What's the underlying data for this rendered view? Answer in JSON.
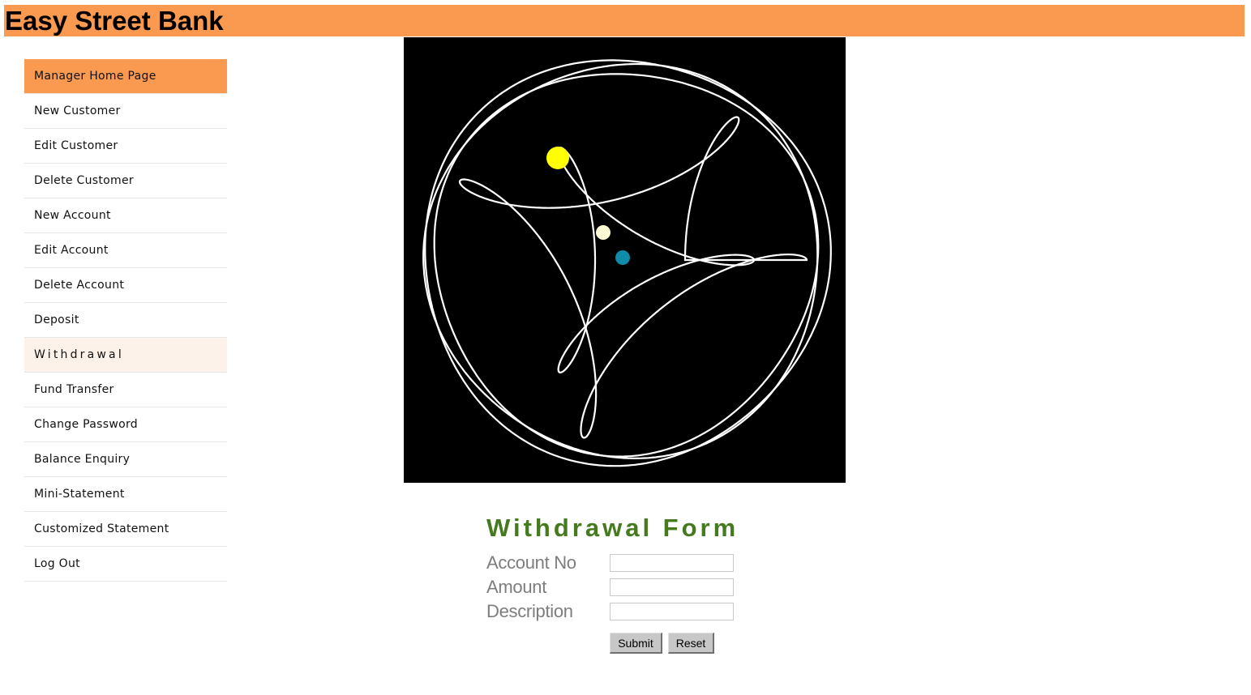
{
  "header": {
    "title": "Easy Street Bank",
    "background": "#f99a50"
  },
  "sidebar": {
    "items": [
      {
        "label": "Manager Home Page"
      },
      {
        "label": "New Customer"
      },
      {
        "label": "Edit Customer"
      },
      {
        "label": "Delete Customer"
      },
      {
        "label": "New Account"
      },
      {
        "label": "Edit Account"
      },
      {
        "label": "Delete Account"
      },
      {
        "label": "Deposit"
      },
      {
        "label": "Withdrawal"
      },
      {
        "label": "Fund Transfer"
      },
      {
        "label": "Change Password"
      },
      {
        "label": "Balance Enquiry"
      },
      {
        "label": "Mini-Statement"
      },
      {
        "label": "Customized Statement"
      },
      {
        "label": "Log Out"
      }
    ],
    "active_color": "#f99a50",
    "current_color": "#fdf2ea"
  },
  "animation": {
    "background": "#000000",
    "stroke": "#ffffff",
    "planet_colors": [
      "#ffff00",
      "#fffbd6",
      "#0e8ba8"
    ]
  },
  "form": {
    "title": "Withdrawal Form",
    "title_color": "#457a1f",
    "fields": [
      {
        "label": "Account No",
        "value": ""
      },
      {
        "label": "Amount",
        "value": ""
      },
      {
        "label": "Description",
        "value": ""
      }
    ],
    "submit_label": "Submit",
    "reset_label": "Reset"
  }
}
